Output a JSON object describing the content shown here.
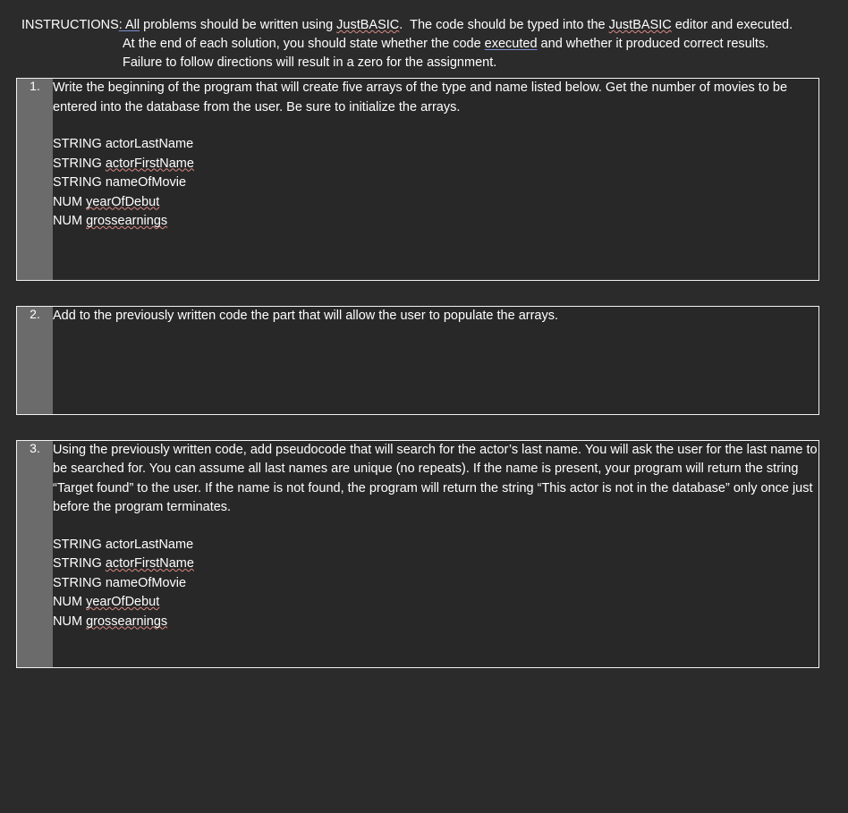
{
  "instructions": {
    "label": "INSTRUCTIONS",
    "emphasis": ": All",
    "line1_rest": " problems should be written using JustBASIC.  The code should be typed into the JustBASIC editor and executed.",
    "line2_a": "At the end of each solution, you should state whether the code ",
    "line2_link": "executed",
    "line2_b": " and whether it produced correct results.",
    "line3": "Failure to follow directions will result in a zero for the assignment.",
    "spell_words": [
      "JustBASIC",
      "JustBASIC"
    ]
  },
  "problems": [
    {
      "number": "1.",
      "prompt": "Write the beginning of the program that will create five arrays of the type and name listed below.  Get the number of movies to be entered into the database from the user.  Be sure to initialize the arrays.",
      "variables": [
        {
          "type": "STRING",
          "name": "actorLastName",
          "misspelled": false
        },
        {
          "type": "STRING",
          "name": "actorFirstName",
          "misspelled": true
        },
        {
          "type": "STRING",
          "name": "nameOfMovie",
          "misspelled": false
        },
        {
          "type": "NUM",
          "name": "yearOfDebut",
          "misspelled": true
        },
        {
          "type": "NUM",
          "name": "grossearnings",
          "misspelled": true
        }
      ],
      "answer": ""
    },
    {
      "number": "2.",
      "prompt": "Add to the previously written code the part that will allow the user to populate the arrays.",
      "variables": [],
      "answer": ""
    },
    {
      "number": "3.",
      "prompt": "Using the previously written code, add pseudocode that will search for the actor’s last name.  You will ask the user for the last name to be searched for.  You can assume all last names are unique (no repeats).  If the name is present, your program will return the string “Target found” to the user.  If the name is not found, the program will return the string “This actor is not in the database” only once just before the program terminates.",
      "variables": [
        {
          "type": "STRING",
          "name": "actorLastName",
          "misspelled": false
        },
        {
          "type": "STRING",
          "name": "actorFirstName",
          "misspelled": true
        },
        {
          "type": "STRING",
          "name": "nameOfMovie",
          "misspelled": false
        },
        {
          "type": "NUM",
          "name": "yearOfDebut",
          "misspelled": true
        },
        {
          "type": "NUM",
          "name": "grossearnings",
          "misspelled": true
        }
      ],
      "answer": ""
    }
  ],
  "colors": {
    "page_background": "#2b2b2b",
    "table_background": "#282828",
    "number_column": "#6b6b6b",
    "border": "#f2f2f2",
    "text": "#ffffff",
    "spellcheck_underline": "#d98b84",
    "link_underline": "#7b8fd0"
  }
}
